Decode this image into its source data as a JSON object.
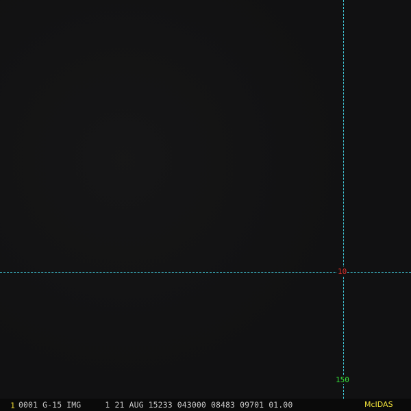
{
  "window": {
    "background": "#111112"
  },
  "overlay": {
    "grid_color": "#3fc6d6",
    "latitude_label": "10",
    "latitude_label_color": "#e0302a",
    "longitude_label": "150",
    "longitude_label_color": "#36e23a"
  },
  "status_bar": {
    "frame_number": "1",
    "image_info": "0001 G-15 IMG     1 21 AUG 15233 043000 08483 09701 01.00",
    "brand": "McIDAS",
    "frame_color": "#e6d232",
    "brand_color": "#f2e23a"
  }
}
